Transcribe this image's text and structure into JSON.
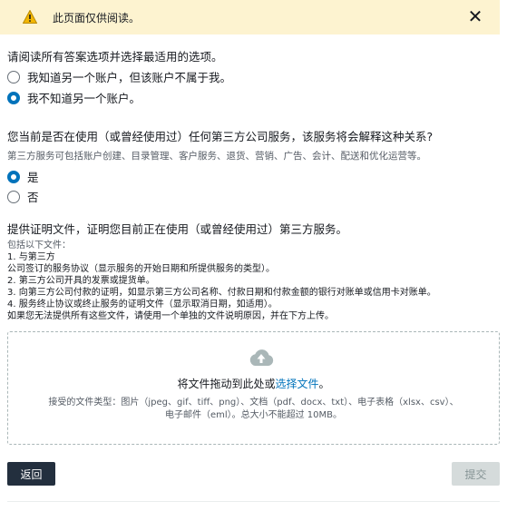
{
  "alert": {
    "text": "此页面仅供阅读。",
    "close_glyph": "✕",
    "icon": "warning-icon",
    "bg_color": "#fdf3d0",
    "icon_color": "#8a6d00"
  },
  "question1": {
    "label": "请阅读所有答案选项并选择最适用的选项。",
    "options": [
      {
        "label": "我知道另一个账户，但该账户不属于我。",
        "checked": false
      },
      {
        "label": "我不知道另一个账户。",
        "checked": true
      }
    ]
  },
  "question2": {
    "label": "您当前是否在使用（或曾经使用过）任何第三方公司服务，该服务将会解释这种关系?",
    "help": "第三方服务可包括账户创建、目录管理、客户服务、退货、营销、广告、会计、配送和优化运营等。",
    "options": [
      {
        "label": "是",
        "checked": true
      },
      {
        "label": "否",
        "checked": false
      }
    ]
  },
  "documents": {
    "label": "提供证明文件，证明您目前正在使用（或曾经使用过）第三方服务。",
    "lines": [
      "包括以下文件：",
      "1. 与第三方",
      "公司签订的服务协议（显示服务的开始日期和所提供服务的类型）。",
      "2. 第三方公司开具的发票或提货单。",
      "3. 向第三方公司付款的证明，如显示第三方公司名称、付款日期和付款金额的银行对账单或信用卡对账单。",
      "4. 服务终止协议或终止服务的证明文件（显示取消日期，如适用）。",
      "如果您无法提供所有这些文件，请使用一个单独的文件说明原因，并在下方上传。"
    ]
  },
  "dropzone": {
    "main_prefix": "将文件拖动到此处或",
    "main_link": "选择文件",
    "main_suffix": "。",
    "accepted_line1": "接受的文件类型：图片（jpeg、gif、tiff、png）、文档（pdf、docx、txt）、电子表格（xlsx、csv）、",
    "accepted_line2": "电子邮件（eml）。总大小不能超过 10MB。",
    "icon": "cloud-upload-icon"
  },
  "buttons": {
    "back": "返回",
    "submit": "提交"
  },
  "colors": {
    "primary": "#232f3e",
    "link": "#0073bb",
    "disabled_bg": "#d5dbdb"
  }
}
